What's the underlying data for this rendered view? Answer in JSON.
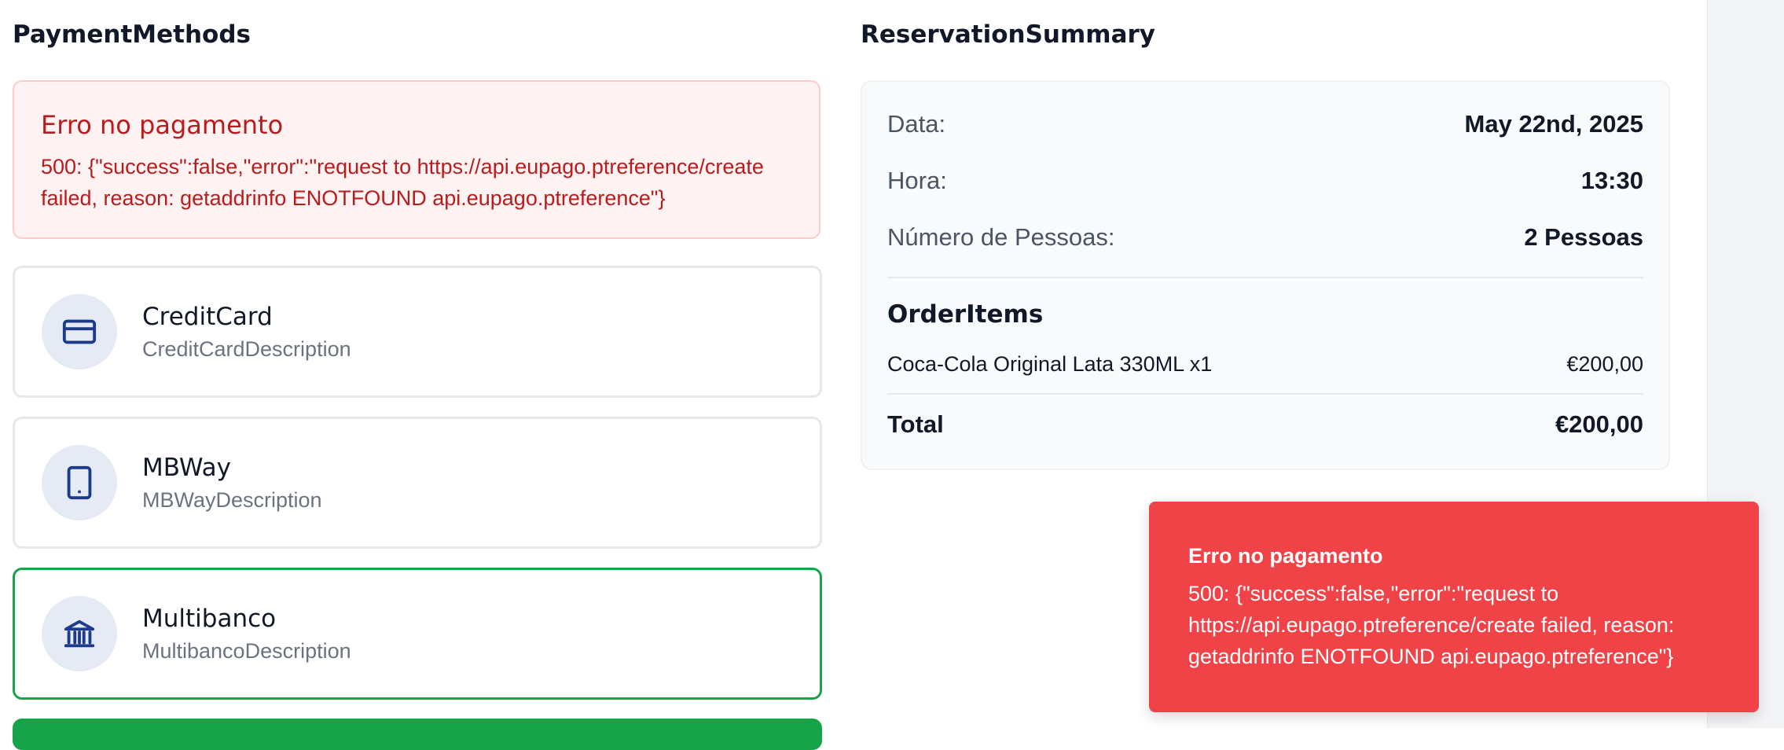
{
  "payment_methods": {
    "title": "PaymentMethods",
    "error": {
      "title": "Erro no pagamento",
      "message": "500: {\"success\":false,\"error\":\"request to https://api.eupago.ptreference/create failed, reason: getaddrinfo ENOTFOUND api.eupago.ptreference\"}"
    },
    "methods": [
      {
        "name": "CreditCard",
        "description": "CreditCardDescription",
        "icon": "credit-card-icon",
        "selected": false
      },
      {
        "name": "MBWay",
        "description": "MBWayDescription",
        "icon": "smartphone-icon",
        "selected": false
      },
      {
        "name": "Multibanco",
        "description": "MultibancoDescription",
        "icon": "bank-icon",
        "selected": true
      }
    ]
  },
  "reservation_summary": {
    "title": "ReservationSummary",
    "rows": [
      {
        "label": "Data:",
        "value": "May 22nd, 2025"
      },
      {
        "label": "Hora:",
        "value": "13:30"
      },
      {
        "label": "Número de Pessoas:",
        "value": "2 Pessoas"
      }
    ],
    "order_items_title": "OrderItems",
    "items": [
      {
        "label": "Coca-Cola Original Lata 330ML x1",
        "price": "€200,00"
      }
    ],
    "total_label": "Total",
    "total_value": "€200,00"
  },
  "toast": {
    "title": "Erro no pagamento",
    "message": "500: {\"success\":false,\"error\":\"request to https://api.eupago.ptreference/create failed, reason: getaddrinfo ENOTFOUND api.eupago.ptreference\"}"
  },
  "colors": {
    "accent_green": "#16a34a",
    "error_red": "#b91c1c",
    "toast_red": "#ef4348",
    "icon_navy": "#1e3a8a"
  }
}
